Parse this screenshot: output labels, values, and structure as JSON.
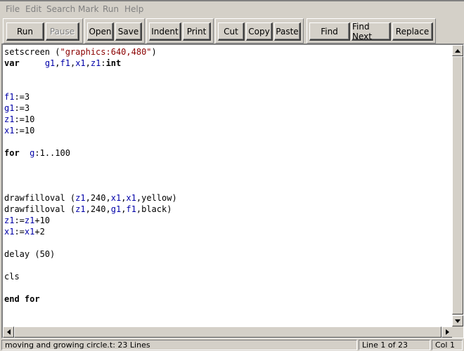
{
  "menu": {
    "items": [
      {
        "label": "File"
      },
      {
        "label": "Edit"
      },
      {
        "label": "Search"
      },
      {
        "label": "Mark"
      },
      {
        "label": "Run"
      },
      {
        "label": "Help"
      }
    ]
  },
  "toolbar": {
    "run": "Run",
    "pause": "Pause",
    "open": "Open",
    "save": "Save",
    "indent": "Indent",
    "print": "Print",
    "cut": "Cut",
    "copy": "Copy",
    "paste": "Paste",
    "find": "Find",
    "find_next": "Find Next",
    "replace": "Replace"
  },
  "editor": {
    "lines": [
      [
        {
          "t": "plain",
          "s": "setscreen ("
        },
        {
          "t": "str",
          "s": "\"graphics:640,480\""
        },
        {
          "t": "plain",
          "s": ")"
        }
      ],
      [
        {
          "t": "kw",
          "s": "var"
        },
        {
          "t": "plain",
          "s": "     "
        },
        {
          "t": "var",
          "s": "g1"
        },
        {
          "t": "plain",
          "s": ","
        },
        {
          "t": "var",
          "s": "f1"
        },
        {
          "t": "plain",
          "s": ","
        },
        {
          "t": "var",
          "s": "x1"
        },
        {
          "t": "plain",
          "s": ","
        },
        {
          "t": "var",
          "s": "z1"
        },
        {
          "t": "plain",
          "s": ":"
        },
        {
          "t": "kw",
          "s": "int"
        }
      ],
      [],
      [],
      [
        {
          "t": "var",
          "s": "f1"
        },
        {
          "t": "plain",
          "s": ":=3"
        }
      ],
      [
        {
          "t": "var",
          "s": "g1"
        },
        {
          "t": "plain",
          "s": ":=3"
        }
      ],
      [
        {
          "t": "var",
          "s": "z1"
        },
        {
          "t": "plain",
          "s": ":=10"
        }
      ],
      [
        {
          "t": "var",
          "s": "x1"
        },
        {
          "t": "plain",
          "s": ":=10"
        }
      ],
      [],
      [
        {
          "t": "kw",
          "s": "for"
        },
        {
          "t": "plain",
          "s": "  "
        },
        {
          "t": "var",
          "s": "g"
        },
        {
          "t": "plain",
          "s": ":1..100"
        }
      ],
      [],
      [],
      [],
      [
        {
          "t": "plain",
          "s": "drawfilloval ("
        },
        {
          "t": "var",
          "s": "z1"
        },
        {
          "t": "plain",
          "s": ",240,"
        },
        {
          "t": "var",
          "s": "x1"
        },
        {
          "t": "plain",
          "s": ","
        },
        {
          "t": "var",
          "s": "x1"
        },
        {
          "t": "plain",
          "s": ",yellow)"
        }
      ],
      [
        {
          "t": "plain",
          "s": "drawfilloval ("
        },
        {
          "t": "var",
          "s": "z1"
        },
        {
          "t": "plain",
          "s": ",240,"
        },
        {
          "t": "var",
          "s": "g1"
        },
        {
          "t": "plain",
          "s": ","
        },
        {
          "t": "var",
          "s": "f1"
        },
        {
          "t": "plain",
          "s": ",black)"
        }
      ],
      [
        {
          "t": "var",
          "s": "z1"
        },
        {
          "t": "plain",
          "s": ":="
        },
        {
          "t": "var",
          "s": "z1"
        },
        {
          "t": "plain",
          "s": "+10"
        }
      ],
      [
        {
          "t": "var",
          "s": "x1"
        },
        {
          "t": "plain",
          "s": ":="
        },
        {
          "t": "var",
          "s": "x1"
        },
        {
          "t": "plain",
          "s": "+2"
        }
      ],
      [],
      [
        {
          "t": "plain",
          "s": "delay (50)"
        }
      ],
      [],
      [
        {
          "t": "plain",
          "s": "cls"
        }
      ],
      [],
      [
        {
          "t": "kw",
          "s": "end"
        },
        {
          "t": "plain",
          "s": " "
        },
        {
          "t": "kw",
          "s": "for"
        }
      ]
    ]
  },
  "status": {
    "message": "moving and growing  circle.t: 23 Lines",
    "line": "Line 1 of 23",
    "col": "Col 1"
  },
  "colors": {
    "keyword": "#000000",
    "variable": "#0000a8",
    "string": "#8b0000",
    "chrome": "#d4d0c8"
  },
  "icons": {
    "scroll_up": "triangle-up-icon",
    "scroll_down": "triangle-down-icon",
    "scroll_left": "triangle-left-icon",
    "scroll_right": "triangle-right-icon"
  }
}
